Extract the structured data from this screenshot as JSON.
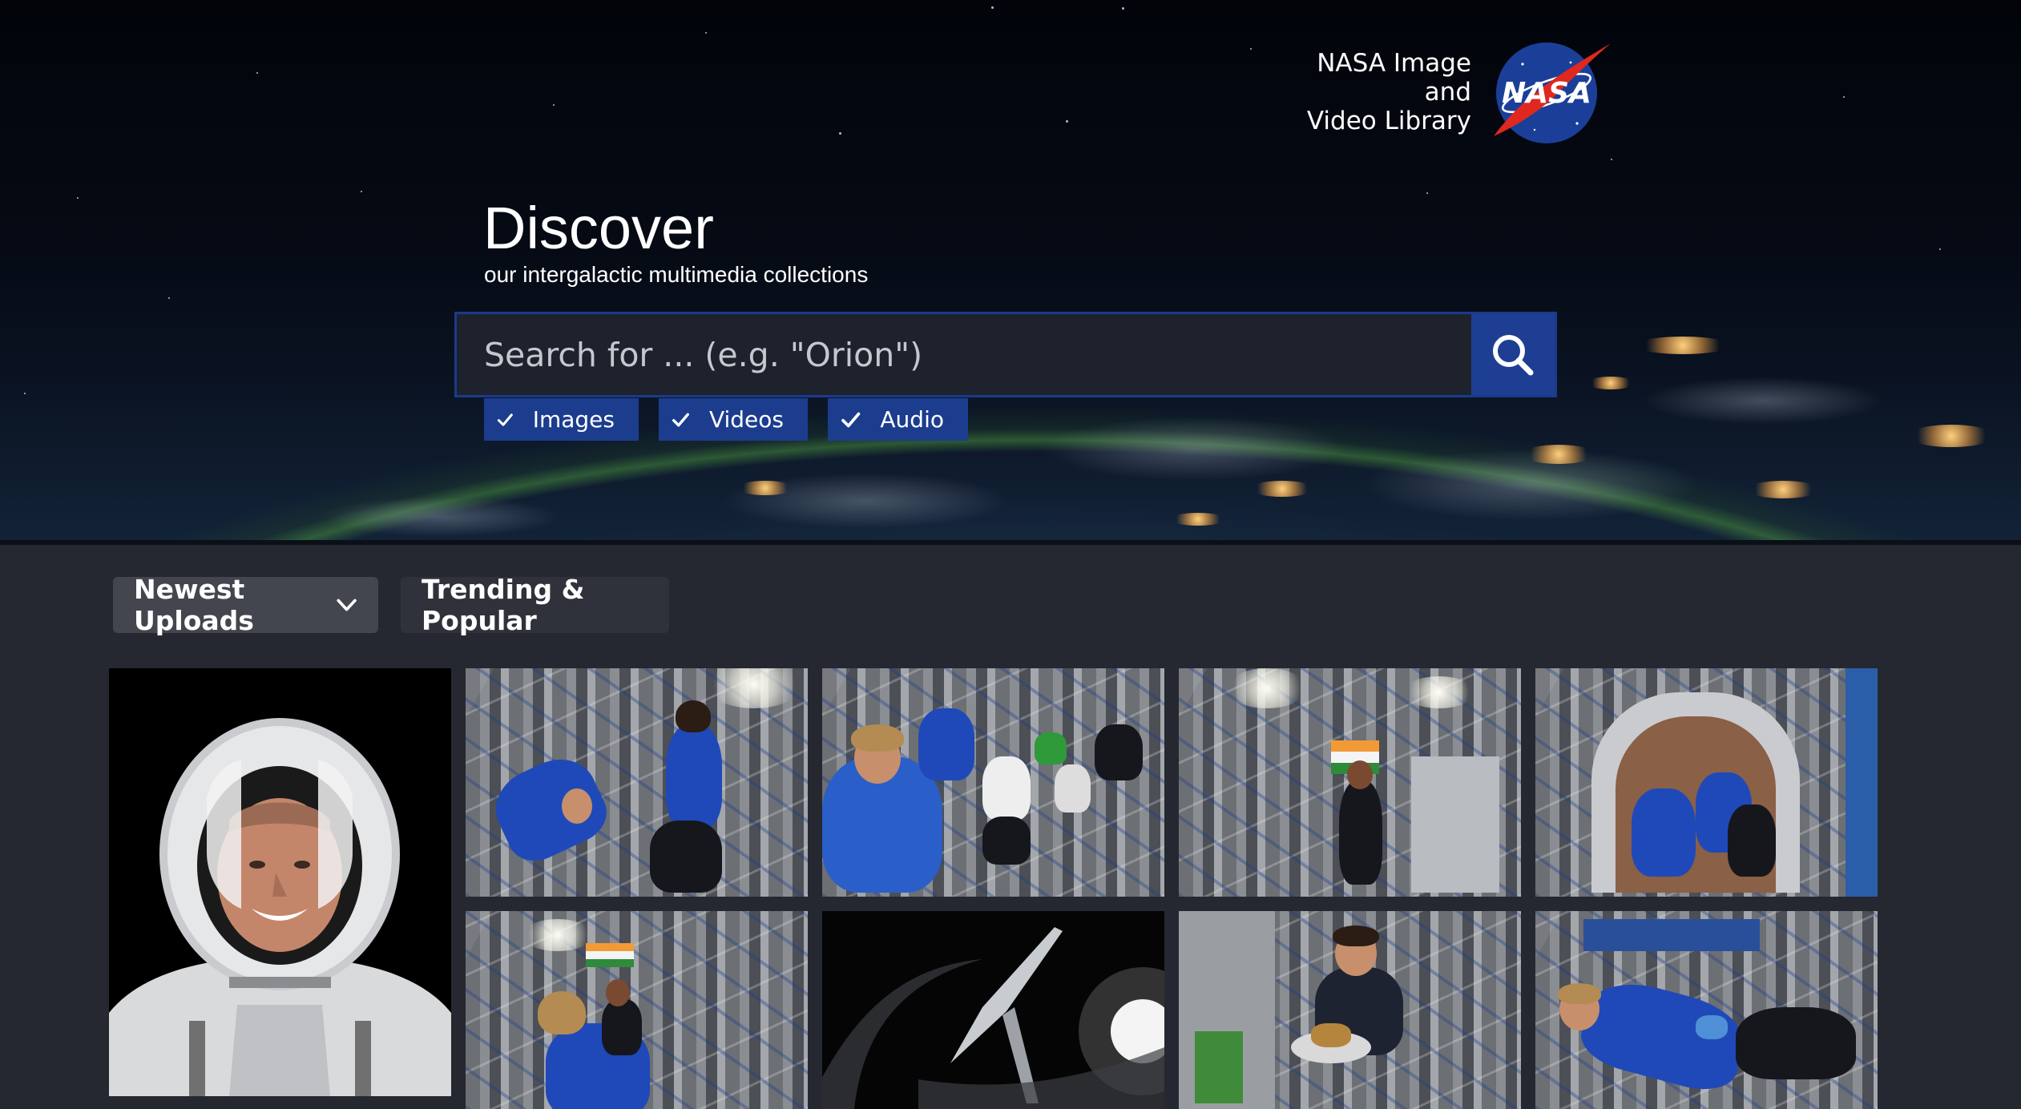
{
  "brand": {
    "line1": "NASA Image and",
    "line2": "Video Library",
    "logo_text": "NASA"
  },
  "hero": {
    "title": "Discover",
    "subtitle": "our intergalactic multimedia collections"
  },
  "search": {
    "placeholder": "Search for ... (e.g. \"Orion\")",
    "value": "",
    "button_icon": "search-icon"
  },
  "filters": [
    {
      "label": "Images",
      "checked": true,
      "icon": "check-icon"
    },
    {
      "label": "Videos",
      "checked": true,
      "icon": "check-icon"
    },
    {
      "label": "Audio",
      "checked": true,
      "icon": "check-icon"
    }
  ],
  "tabs": [
    {
      "label": "Newest Uploads",
      "active": true,
      "icon": "chevron-down-icon"
    },
    {
      "label": "Trending & Popular",
      "active": false
    }
  ],
  "colors": {
    "accent": "#1d3e92",
    "accent_border": "#1b3a8c",
    "page_bg": "#252830",
    "tab_active": "#43464f",
    "tab_inactive": "#2f323b",
    "nasa_logo_blue": "#1b3f99",
    "nasa_logo_red": "#e0281f"
  }
}
